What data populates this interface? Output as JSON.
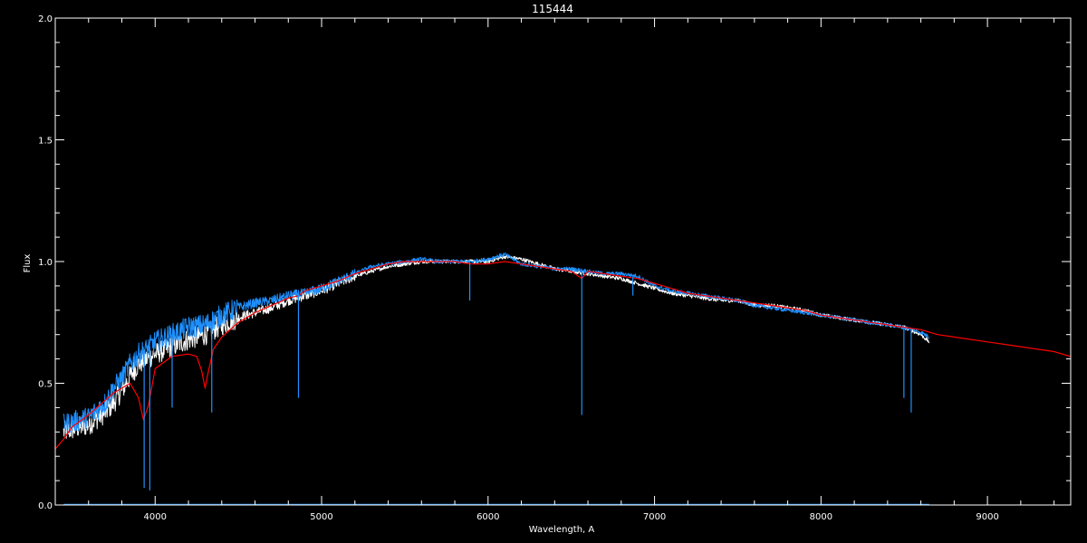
{
  "chart_data": {
    "type": "line",
    "title": "115444",
    "xlabel": "Wavelength, A",
    "ylabel": "Flux",
    "xlim": [
      3400,
      9500
    ],
    "ylim": [
      0.0,
      2.0
    ],
    "x_ticks": [
      4000,
      5000,
      6000,
      7000,
      8000,
      9000
    ],
    "x_tick_labels": [
      "4000",
      "5000",
      "6000",
      "7000",
      "8000",
      "9000"
    ],
    "y_ticks": [
      0.0,
      0.5,
      1.0,
      1.5,
      2.0
    ],
    "y_tick_labels": [
      "0.0",
      "0.5",
      "1.0",
      "1.5",
      "2.0"
    ],
    "grid": false,
    "series": [
      {
        "color": "#ffffff",
        "x": [
          3450,
          3500,
          3600,
          3700,
          3750,
          3800,
          3850,
          3900,
          3950,
          4000,
          4100,
          4200,
          4300,
          4400,
          4500,
          4600,
          4700,
          4800,
          4900,
          5000,
          5100,
          5200,
          5300,
          5400,
          5500,
          5600,
          5700,
          5800,
          5900,
          6000,
          6100,
          6200,
          6300,
          6400,
          6500,
          6600,
          6700,
          6800,
          6900,
          7000,
          7100,
          7200,
          7300,
          7400,
          7500,
          7600,
          7700,
          7800,
          7900,
          8000,
          8100,
          8200,
          8300,
          8400,
          8500,
          8600,
          8650
        ],
        "y": [
          0.3,
          0.31,
          0.33,
          0.38,
          0.42,
          0.47,
          0.53,
          0.58,
          0.6,
          0.62,
          0.65,
          0.68,
          0.7,
          0.74,
          0.77,
          0.79,
          0.81,
          0.84,
          0.86,
          0.88,
          0.91,
          0.94,
          0.96,
          0.98,
          0.99,
          1.0,
          1.0,
          1.0,
          1.0,
          1.0,
          1.02,
          1.01,
          0.99,
          0.97,
          0.96,
          0.95,
          0.94,
          0.93,
          0.91,
          0.89,
          0.87,
          0.86,
          0.85,
          0.84,
          0.84,
          0.82,
          0.82,
          0.81,
          0.8,
          0.78,
          0.77,
          0.76,
          0.75,
          0.74,
          0.73,
          0.7,
          0.67
        ]
      },
      {
        "color": "#1e90ff",
        "x": [
          3450,
          3500,
          3600,
          3700,
          3750,
          3800,
          3850,
          3900,
          3950,
          4000,
          4100,
          4200,
          4300,
          4400,
          4500,
          4600,
          4700,
          4800,
          4900,
          5000,
          5100,
          5200,
          5300,
          5400,
          5500,
          5600,
          5700,
          5800,
          5900,
          6000,
          6100,
          6200,
          6300,
          6400,
          6500,
          6600,
          6700,
          6800,
          6900,
          7000,
          7100,
          7200,
          7300,
          7400,
          7500,
          7600,
          7700,
          7800,
          7900,
          8000,
          8100,
          8200,
          8300,
          8400,
          8500,
          8600,
          8650
        ],
        "y": [
          0.33,
          0.34,
          0.36,
          0.42,
          0.48,
          0.52,
          0.58,
          0.62,
          0.64,
          0.67,
          0.7,
          0.73,
          0.74,
          0.78,
          0.81,
          0.83,
          0.84,
          0.86,
          0.87,
          0.89,
          0.92,
          0.95,
          0.98,
          0.99,
          1.0,
          1.01,
          1.0,
          1.0,
          1.0,
          1.01,
          1.03,
          0.99,
          0.98,
          0.97,
          0.97,
          0.96,
          0.95,
          0.95,
          0.94,
          0.9,
          0.88,
          0.87,
          0.86,
          0.85,
          0.84,
          0.82,
          0.81,
          0.8,
          0.79,
          0.78,
          0.77,
          0.76,
          0.75,
          0.74,
          0.73,
          0.71,
          0.69
        ]
      },
      {
        "color": "#ff0000",
        "x": [
          3400,
          3450,
          3500,
          3600,
          3700,
          3750,
          3800,
          3850,
          3900,
          3930,
          3960,
          4000,
          4100,
          4200,
          4250,
          4280,
          4300,
          4320,
          4350,
          4400,
          4500,
          4600,
          4700,
          4800,
          4860,
          4900,
          5000,
          5100,
          5200,
          5300,
          5400,
          5500,
          5600,
          5700,
          5800,
          5900,
          6000,
          6100,
          6200,
          6300,
          6400,
          6500,
          6563,
          6600,
          6700,
          6800,
          6900,
          7000,
          7100,
          7200,
          7300,
          7400,
          7500,
          7600,
          7700,
          7800,
          7900,
          8000,
          8100,
          8200,
          8300,
          8400,
          8500,
          8600,
          8700,
          8800,
          9000,
          9200,
          9400,
          9500
        ],
        "y": [
          0.23,
          0.27,
          0.32,
          0.37,
          0.43,
          0.46,
          0.48,
          0.5,
          0.44,
          0.35,
          0.41,
          0.56,
          0.61,
          0.62,
          0.61,
          0.55,
          0.48,
          0.55,
          0.64,
          0.69,
          0.75,
          0.79,
          0.82,
          0.85,
          0.86,
          0.88,
          0.9,
          0.92,
          0.95,
          0.97,
          0.99,
          1.0,
          1.0,
          1.0,
          1.0,
          0.99,
          0.99,
          1.0,
          0.99,
          0.98,
          0.97,
          0.96,
          0.93,
          0.96,
          0.95,
          0.94,
          0.93,
          0.91,
          0.89,
          0.87,
          0.86,
          0.85,
          0.84,
          0.83,
          0.82,
          0.81,
          0.8,
          0.78,
          0.77,
          0.76,
          0.75,
          0.74,
          0.73,
          0.72,
          0.7,
          0.69,
          0.67,
          0.65,
          0.63,
          0.61
        ]
      }
    ],
    "absorption_lines": [
      {
        "x": 3934,
        "depth": 0.07
      },
      {
        "x": 3968,
        "depth": 0.06
      },
      {
        "x": 4102,
        "depth": 0.4
      },
      {
        "x": 4340,
        "depth": 0.38
      },
      {
        "x": 4861,
        "depth": 0.44
      },
      {
        "x": 5890,
        "depth": 0.84
      },
      {
        "x": 6563,
        "depth": 0.37
      },
      {
        "x": 6870,
        "depth": 0.86
      },
      {
        "x": 8498,
        "depth": 0.44
      },
      {
        "x": 8542,
        "depth": 0.38
      }
    ],
    "noise_floor": {
      "color": "#1e90ff",
      "x": [
        3450,
        8650
      ],
      "y": [
        0.002,
        0.002
      ]
    }
  }
}
